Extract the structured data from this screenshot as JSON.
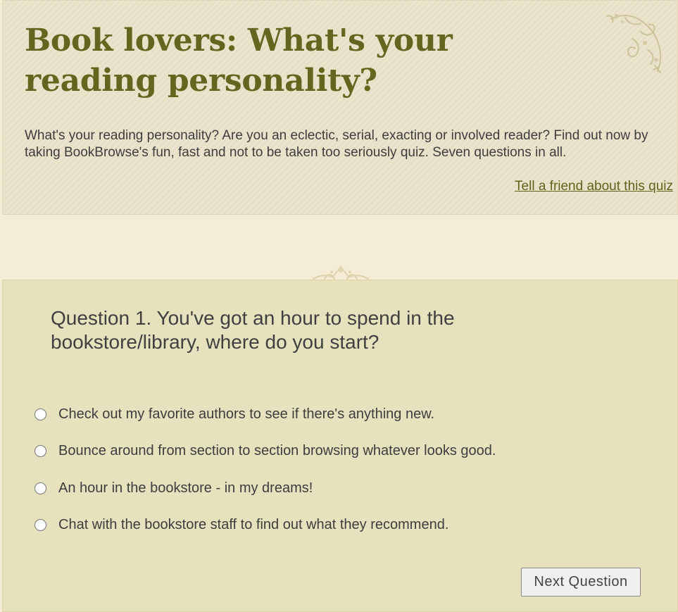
{
  "header": {
    "title": "Book lovers: What's your reading personality?",
    "intro": "What's your reading personality? Are you an eclectic, serial, exacting or involved reader? Find out now by taking BookBrowse's fun, fast and not to be taken too seriously quiz. Seven questions in all.",
    "tell_friend_link": "Tell a friend about this quiz",
    "ornament_icon": "floral-corner-ornament-icon"
  },
  "divider": {
    "ornament_icon": "floral-divider-ornament-icon"
  },
  "quiz": {
    "question": "Question 1. You've got an hour to spend in the bookstore/library, where do you start?",
    "options": [
      {
        "label": "Check out my favorite authors to see if there's anything new.",
        "selected": false
      },
      {
        "label": "Bounce around from section to section browsing whatever looks good.",
        "selected": false
      },
      {
        "label": "An hour in the bookstore - in my dreams!",
        "selected": false
      },
      {
        "label": "Chat with the bookstore staff to find out what they recommend.",
        "selected": false
      }
    ],
    "next_button": "Next Question"
  },
  "colors": {
    "page_background": "#f4ecd5",
    "header_background": "#e8e0c6",
    "title_color": "#62661f",
    "link_color": "#5f631d",
    "quiz_background": "#e6e2bd"
  }
}
